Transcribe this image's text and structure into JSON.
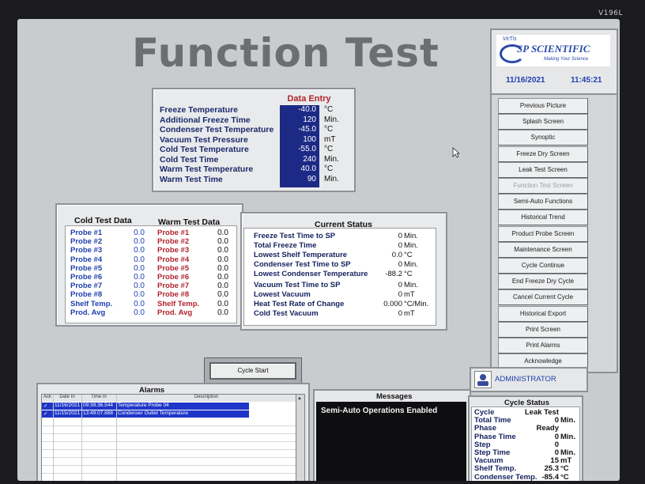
{
  "bezel": {
    "model": "V196L"
  },
  "title": "Function Test",
  "brand": {
    "prefix": "VirTis",
    "name": "SP SCIENTIFIC",
    "tagline": "Making Your Science"
  },
  "clock": {
    "date": "11/16/2021",
    "time": "11:45:21"
  },
  "data_entry": {
    "heading": "Data Entry",
    "rows": [
      {
        "label": "Freeze Temperature",
        "value": "-40.0",
        "unit": "°C"
      },
      {
        "label": "Additional Freeze Time",
        "value": "120",
        "unit": "Min."
      },
      {
        "label": "Condenser Test Temperature",
        "value": "-45.0",
        "unit": "°C"
      },
      {
        "label": "Vacuum Test Pressure",
        "value": "100",
        "unit": "mT"
      },
      {
        "label": "Cold Test Temperature",
        "value": "-55.0",
        "unit": "°C"
      },
      {
        "label": "Cold Test Time",
        "value": "240",
        "unit": "Min."
      },
      {
        "label": "Warm Test Temperature",
        "value": "40.0",
        "unit": "°C"
      },
      {
        "label": "Warm Test Time",
        "value": "90",
        "unit": "Min."
      }
    ]
  },
  "cold_test": {
    "heading": "Cold Test Data",
    "rows": [
      {
        "label": "Probe #1",
        "value": "0.0"
      },
      {
        "label": "Probe #2",
        "value": "0.0"
      },
      {
        "label": "Probe #3",
        "value": "0.0"
      },
      {
        "label": "Probe #4",
        "value": "0.0"
      },
      {
        "label": "Probe #5",
        "value": "0.0"
      },
      {
        "label": "Probe #6",
        "value": "0.0"
      },
      {
        "label": "Probe #7",
        "value": "0.0"
      },
      {
        "label": "Probe #8",
        "value": "0.0"
      },
      {
        "label": "Shelf Temp.",
        "value": "0.0"
      },
      {
        "label": "Prod. Avg",
        "value": "0.0"
      }
    ]
  },
  "warm_test": {
    "heading": "Warm Test Data",
    "rows": [
      {
        "label": "Probe #1",
        "value": "0.0"
      },
      {
        "label": "Probe #2",
        "value": "0.0"
      },
      {
        "label": "Probe #3",
        "value": "0.0"
      },
      {
        "label": "Probe #4",
        "value": "0.0"
      },
      {
        "label": "Probe #5",
        "value": "0.0"
      },
      {
        "label": "Probe #6",
        "value": "0.0"
      },
      {
        "label": "Probe #7",
        "value": "0.0"
      },
      {
        "label": "Probe #8",
        "value": "0.0"
      },
      {
        "label": "Shelf Temp.",
        "value": "0.0"
      },
      {
        "label": "Prod. Avg",
        "value": "0.0"
      }
    ]
  },
  "current_status": {
    "heading": "Current Status",
    "rows": [
      {
        "label": "Freeze Test Time to SP",
        "value": "0",
        "unit": "Min."
      },
      {
        "label": "Total Freeze Time",
        "value": "0",
        "unit": "Min."
      },
      {
        "label": "Lowest Shelf Temperature",
        "value": "0.0",
        "unit": "°C"
      },
      {
        "label": "Condenser Test Time to SP",
        "value": "0",
        "unit": "Min."
      },
      {
        "label": "Lowest Condenser Temperature",
        "value": "-88.2",
        "unit": "°C"
      },
      {
        "label": "Vacuum Test Time to SP",
        "value": "0",
        "unit": "Min."
      },
      {
        "label": "Lowest Vacuum",
        "value": "0",
        "unit": "mT"
      },
      {
        "label": "Heat Test Rate of Change",
        "value": "0.000",
        "unit": "°C/Min."
      },
      {
        "label": "Cold Test Vacuum",
        "value": "0",
        "unit": "mT"
      }
    ]
  },
  "cycle_start": {
    "label": "Cycle Start"
  },
  "nav": [
    {
      "label": "Previous Picture",
      "enabled": true
    },
    {
      "label": "Splash Screen",
      "enabled": true
    },
    {
      "label": "Synoptic",
      "enabled": true
    },
    {
      "label": "Freeze Dry Screen",
      "enabled": true
    },
    {
      "label": "Leak Test Screen",
      "enabled": true
    },
    {
      "label": "Function Test Screen",
      "enabled": false
    },
    {
      "label": "Semi-Auto Functions",
      "enabled": true
    },
    {
      "label": "Historical Trend",
      "enabled": true
    },
    {
      "label": "Product Probe Screen",
      "enabled": true
    },
    {
      "label": "Maintenance Screen",
      "enabled": true
    },
    {
      "label": "Cycle Continue",
      "enabled": true
    },
    {
      "label": "End Freeze Dry Cycle",
      "enabled": true
    },
    {
      "label": "Cancel Current Cycle",
      "enabled": true
    },
    {
      "label": "Historical Export",
      "enabled": true
    },
    {
      "label": "Print Screen",
      "enabled": true
    },
    {
      "label": "Print Alarms",
      "enabled": true
    },
    {
      "label": "Acknowledge",
      "enabled": true
    }
  ],
  "user": {
    "name": "ADMINISTRATOR"
  },
  "alarms": {
    "heading": "Alarms",
    "columns": [
      "Ack",
      "Date In",
      "Time In",
      "Description"
    ],
    "rows": [
      {
        "ack": "✓",
        "date": "11/16/2021",
        "time": "09:39:36.544",
        "desc": "Temperature Probe 04"
      },
      {
        "ack": "✓",
        "date": "11/15/2021",
        "time": "13:49:07.888",
        "desc": "Condenser Outlet Temperature"
      }
    ]
  },
  "messages": {
    "heading": "Messages",
    "text": "Semi-Auto Operations Enabled"
  },
  "cycle_status": {
    "heading": "Cycle Status",
    "rows": [
      {
        "label": "Cycle",
        "value": "Leak Test",
        "unit": ""
      },
      {
        "label": "Total Time",
        "value": "0",
        "unit": "Min."
      },
      {
        "label": "Phase",
        "value": "Ready",
        "unit": ""
      },
      {
        "label": "Phase Time",
        "value": "0",
        "unit": "Min."
      },
      {
        "label": "Step",
        "value": "0",
        "unit": ""
      },
      {
        "label": "Step Time",
        "value": "0",
        "unit": "Min."
      },
      {
        "label": "Vacuum",
        "value": "15",
        "unit": "mT"
      },
      {
        "label": "Shelf Temp.",
        "value": "25.3",
        "unit": "°C"
      },
      {
        "label": "Condenser Temp.",
        "value": "-85.4",
        "unit": "°C"
      }
    ]
  },
  "colors": {
    "accent_blue": "#1f3fb0",
    "alarm_row": "#1e36c8",
    "data_entry_bg": "#1c2a86",
    "warm_red": "#b3232c"
  }
}
